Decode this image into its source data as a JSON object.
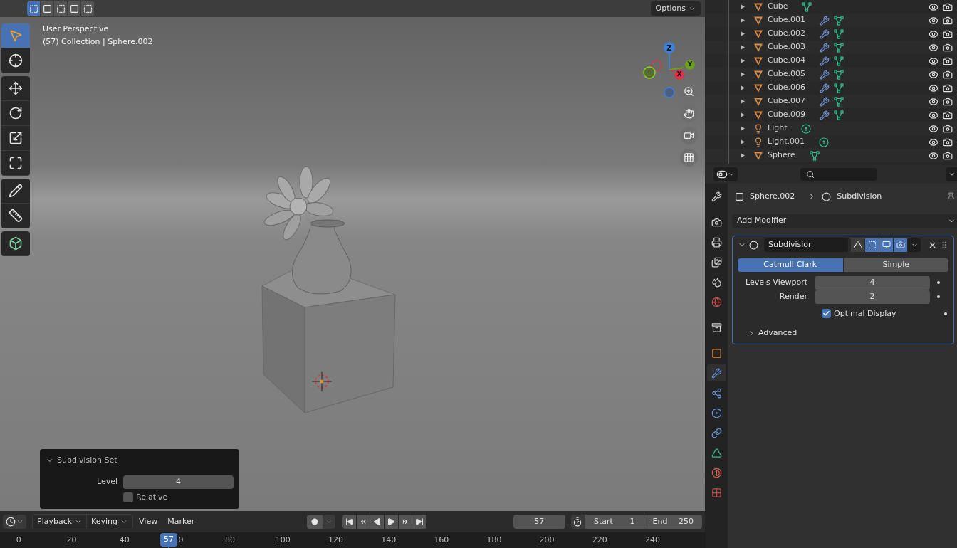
{
  "header": {
    "select_modes": [
      {
        "selected": true
      },
      {
        "selected": false
      },
      {
        "selected": false
      },
      {
        "selected": false
      },
      {
        "selected": false
      }
    ],
    "options": "Options"
  },
  "viewport": {
    "overlay": [
      "User Perspective",
      "(57) Collection | Sphere.002"
    ],
    "tool_groups": [
      [
        {
          "selected": true
        },
        {
          "selected": false
        }
      ],
      [
        {
          "selected": false
        },
        {
          "selected": false
        },
        {
          "selected": false
        },
        {
          "selected": false
        }
      ],
      [
        {
          "selected": false
        },
        {
          "selected": false
        }
      ],
      [
        {
          "selected": false
        }
      ]
    ],
    "gizmo": {
      "z": "Z",
      "y": "Y",
      "x": "X"
    }
  },
  "operator_panel": {
    "title": "Subdivision Set",
    "expanded": true,
    "level_label": "Level",
    "level": "4",
    "relative": {
      "label": "Relative",
      "checked": false
    }
  },
  "timeline": {
    "menus": [
      {
        "label": "Playback",
        "dropdown": true
      },
      {
        "label": "Keying",
        "dropdown": true
      },
      {
        "label": "View",
        "dropdown": false
      },
      {
        "label": "Marker",
        "dropdown": false
      }
    ],
    "current_frame": "57",
    "start": {
      "label": "Start",
      "value": "1"
    },
    "end": {
      "label": "End",
      "value": "250"
    },
    "ticks": [
      "0",
      "20",
      "40",
      "0",
      "80",
      "100",
      "120",
      "140",
      "160",
      "180",
      "200",
      "220",
      "240"
    ],
    "playhead": "57"
  },
  "outliner": {
    "rows": [
      {
        "name": "Cube",
        "kind": "mesh",
        "modifier": false
      },
      {
        "name": "Cube.001",
        "kind": "mesh",
        "modifier": true
      },
      {
        "name": "Cube.002",
        "kind": "mesh",
        "modifier": true
      },
      {
        "name": "Cube.003",
        "kind": "mesh",
        "modifier": true
      },
      {
        "name": "Cube.004",
        "kind": "mesh",
        "modifier": true
      },
      {
        "name": "Cube.005",
        "kind": "mesh",
        "modifier": true
      },
      {
        "name": "Cube.006",
        "kind": "mesh",
        "modifier": true
      },
      {
        "name": "Cube.007",
        "kind": "mesh",
        "modifier": true
      },
      {
        "name": "Cube.009",
        "kind": "mesh",
        "modifier": true
      },
      {
        "name": "Light",
        "kind": "light",
        "modifier": false
      },
      {
        "name": "Light.001",
        "kind": "light",
        "modifier": false
      },
      {
        "name": "Sphere",
        "kind": "mesh",
        "modifier": false
      }
    ]
  },
  "properties": {
    "tabs": [
      {
        "selected": false
      },
      {
        "selected": false
      },
      {
        "selected": false
      },
      {
        "selected": false
      },
      {
        "selected": false
      },
      {
        "selected": false
      },
      {
        "selected": false
      },
      {
        "selected": false
      },
      {
        "selected": true
      },
      {
        "selected": false
      },
      {
        "selected": false
      },
      {
        "selected": false
      },
      {
        "selected": false
      },
      {
        "selected": false
      },
      {
        "selected": false
      }
    ],
    "breadcrumb": [
      "Sphere.002",
      "Subdivision"
    ],
    "add_modifier": "Add Modifier",
    "modifier": {
      "name": "Subdivision",
      "expanded": true,
      "toggles": [
        {
          "on": false
        },
        {
          "on": true
        },
        {
          "on": true
        },
        {
          "on": true
        }
      ],
      "methods": [
        {
          "label": "Catmull-Clark",
          "selected": true
        },
        {
          "label": "Simple",
          "selected": false
        }
      ],
      "fields": [
        {
          "label": "Levels Viewport",
          "value": "4"
        },
        {
          "label": "Render",
          "value": "2"
        }
      ],
      "optimal_display": {
        "label": "Optimal Display",
        "checked": true
      },
      "advanced": {
        "label": "Advanced",
        "expanded": false
      }
    }
  }
}
